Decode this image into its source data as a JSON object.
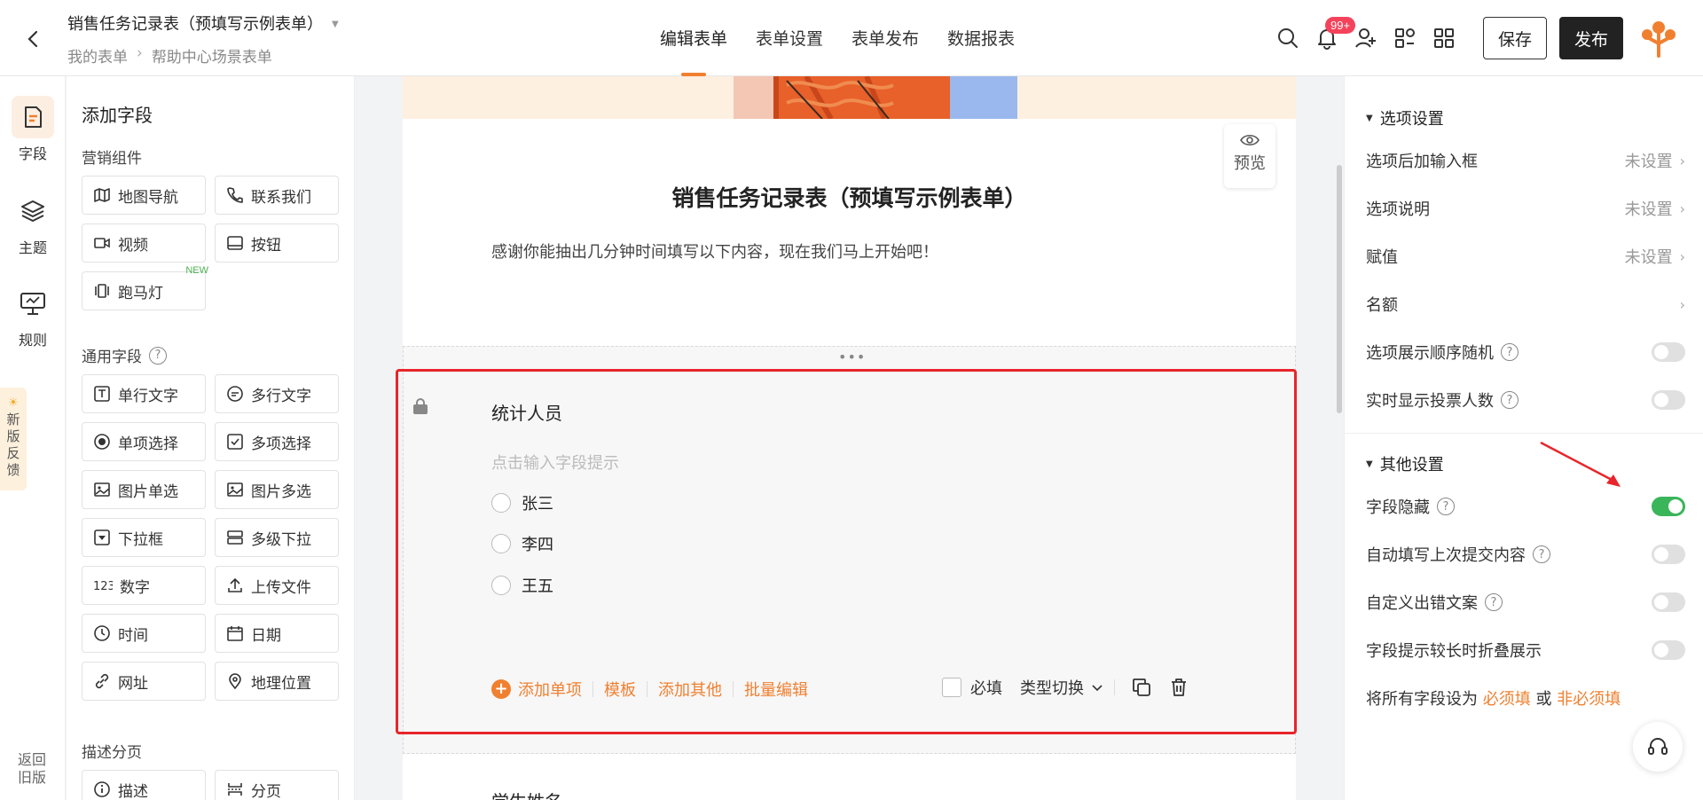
{
  "header": {
    "form_title": "销售任务记录表（预填写示例表单）",
    "breadcrumb": [
      "我的表单",
      "帮助中心场景表单"
    ],
    "tabs": [
      "编辑表单",
      "表单设置",
      "表单发布",
      "数据报表"
    ],
    "active_tab": 0,
    "notification_badge": "99+",
    "save_label": "保存",
    "publish_label": "发布"
  },
  "rail": {
    "items": [
      {
        "label": "字段",
        "icon": "form-field-icon",
        "active": true
      },
      {
        "label": "主题",
        "icon": "layers-icon",
        "active": false
      },
      {
        "label": "规则",
        "icon": "monitor-rule-icon",
        "active": false
      }
    ],
    "feedback": [
      "新",
      "版",
      "反",
      "馈"
    ],
    "back_old": "返回旧版"
  },
  "field_panel": {
    "title": "添加字段",
    "sections": {
      "marketing": "营销组件",
      "general": "通用字段",
      "describe": "描述分页"
    },
    "marketing": [
      {
        "label": "地图导航",
        "icon": "map-icon"
      },
      {
        "label": "联系我们",
        "icon": "phone-icon"
      },
      {
        "label": "视频",
        "icon": "video-icon"
      },
      {
        "label": "按钮",
        "icon": "button-icon"
      },
      {
        "label": "跑马灯",
        "icon": "marquee-icon",
        "tag": "NEW"
      }
    ],
    "general": [
      {
        "label": "单行文字",
        "icon": "text-icon"
      },
      {
        "label": "多行文字",
        "icon": "multiline-icon"
      },
      {
        "label": "单项选择",
        "icon": "radio-icon"
      },
      {
        "label": "多项选择",
        "icon": "checkbox-icon"
      },
      {
        "label": "图片单选",
        "icon": "image-icon"
      },
      {
        "label": "图片多选",
        "icon": "image-multi-icon"
      },
      {
        "label": "下拉框",
        "icon": "dropdown-icon"
      },
      {
        "label": "多级下拉",
        "icon": "cascade-icon"
      },
      {
        "label": "数字",
        "icon": "number-icon"
      },
      {
        "label": "上传文件",
        "icon": "upload-icon"
      },
      {
        "label": "时间",
        "icon": "clock-icon"
      },
      {
        "label": "日期",
        "icon": "calendar-icon"
      },
      {
        "label": "网址",
        "icon": "link-icon"
      },
      {
        "label": "地理位置",
        "icon": "location-icon"
      }
    ],
    "describe": [
      {
        "label": "描述",
        "icon": "info-icon"
      },
      {
        "label": "分页",
        "icon": "page-break-icon"
      }
    ]
  },
  "canvas": {
    "preview_label": "预览",
    "form_title": "销售任务记录表（预填写示例表单）",
    "form_desc": "感谢你能抽出几分钟时间填写以下内容，现在我们马上开始吧！",
    "field": {
      "title": "统计人员",
      "hint_placeholder": "点击输入字段提示",
      "options": [
        "张三",
        "李四",
        "王五"
      ],
      "actions": [
        "添加单项",
        "模板",
        "添加其他",
        "批量编辑"
      ],
      "required_label": "必填",
      "type_switch": "类型切换"
    },
    "next_field_title": "学生姓名"
  },
  "right_panel": {
    "option_settings": {
      "title": "选项设置",
      "rows": [
        {
          "label": "选项后加输入框",
          "value": "未设置"
        },
        {
          "label": "选项说明",
          "value": "未设置"
        },
        {
          "label": "赋值",
          "value": "未设置"
        },
        {
          "label": "名额",
          "value": ""
        }
      ],
      "toggles": [
        {
          "label": "选项展示顺序随机",
          "on": false
        },
        {
          "label": "实时显示投票人数",
          "on": false
        }
      ]
    },
    "other_settings": {
      "title": "其他设置",
      "toggles": [
        {
          "label": "字段隐藏",
          "on": true,
          "help": true
        },
        {
          "label": "自动填写上次提交内容",
          "on": false,
          "help": true
        },
        {
          "label": "自定义出错文案",
          "on": false,
          "help": true
        },
        {
          "label": "字段提示较长时折叠展示",
          "on": false,
          "help": false
        }
      ]
    },
    "all_fields": {
      "prefix": "将所有字段设为",
      "required": "必须填",
      "or": "或",
      "optional": "非必须填"
    }
  },
  "colors": {
    "accent": "#f08030",
    "selection": "#e8252a",
    "toggle_on": "#3ab55a"
  }
}
